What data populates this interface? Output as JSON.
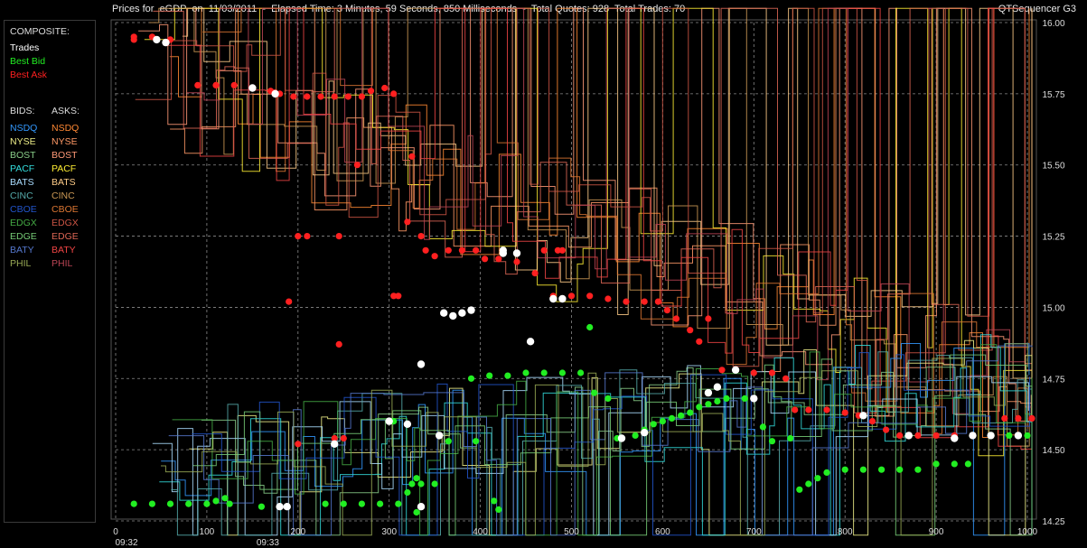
{
  "header": {
    "title": "Prices for  eGDP  on  11/03/2011  -  Elapsed Time: 3 Minutes, 59 Seconds, 850 Milliseconds  -  Total Quotes: 928  Total Trades: 70",
    "app_name": "QTSequencer G3"
  },
  "legend": {
    "composite_header": "COMPOSITE:",
    "composite": [
      {
        "label": "Trades",
        "color": "#ffffff"
      },
      {
        "label": "Best Bid",
        "color": "#22ee22"
      },
      {
        "label": "Best Ask",
        "color": "#ff2020"
      }
    ],
    "bids_header": "BIDS:",
    "asks_header": "ASKS:",
    "exchanges": [
      {
        "bid": "NSDQ",
        "ask": "NSDQ",
        "bid_color": "#3399ff",
        "ask_color": "#ff8833"
      },
      {
        "bid": "NYSE",
        "ask": "NYSE",
        "bid_color": "#eeee88",
        "ask_color": "#ff9966"
      },
      {
        "bid": "BOST",
        "ask": "BOST",
        "bid_color": "#88cc88",
        "ask_color": "#ff9977"
      },
      {
        "bid": "PACF",
        "ask": "PACF",
        "bid_color": "#33dddd",
        "ask_color": "#ffee33"
      },
      {
        "bid": "BATS",
        "ask": "BATS",
        "bid_color": "#aaddff",
        "ask_color": "#ffcc88"
      },
      {
        "bid": "CINC",
        "ask": "CINC",
        "bid_color": "#55aaaa",
        "ask_color": "#cc9955"
      },
      {
        "bid": "CBOE",
        "ask": "CBOE",
        "bid_color": "#2255cc",
        "ask_color": "#dd7733"
      },
      {
        "bid": "EDGX",
        "ask": "EDGX",
        "bid_color": "#44aa44",
        "ask_color": "#cc5544"
      },
      {
        "bid": "EDGE",
        "ask": "EDGE",
        "bid_color": "#77cc77",
        "ask_color": "#dd6655"
      },
      {
        "bid": "BATY",
        "ask": "BATY",
        "bid_color": "#5577cc",
        "ask_color": "#ee4444"
      },
      {
        "bid": "PHIL",
        "ask": "PHIL",
        "bid_color": "#99aa55",
        "ask_color": "#bb4455"
      }
    ]
  },
  "chart_data": {
    "type": "scatter",
    "x_ticks": [
      0,
      100,
      200,
      300,
      400,
      500,
      600,
      700,
      800,
      900,
      1000
    ],
    "time_labels": [
      {
        "x": 0,
        "label": "09:32"
      },
      {
        "x": 155,
        "label": "09:33"
      }
    ],
    "xlim": [
      0,
      1000
    ],
    "y_ticks": [
      "14.25",
      "14.50",
      "14.75",
      "15.00",
      "15.25",
      "15.50",
      "15.75",
      "16.00"
    ],
    "ylim": [
      14.25,
      16.0
    ],
    "grid": true,
    "series": [
      {
        "name": "Best Ask",
        "color": "#ff2020",
        "points": [
          [
            20,
            15.95
          ],
          [
            40,
            15.95
          ],
          [
            60,
            15.94
          ],
          [
            90,
            15.78
          ],
          [
            110,
            15.78
          ],
          [
            130,
            15.78
          ],
          [
            150,
            15.77
          ],
          [
            170,
            15.76
          ],
          [
            180,
            15.75
          ],
          [
            195,
            15.74
          ],
          [
            210,
            15.74
          ],
          [
            225,
            15.74
          ],
          [
            240,
            15.74
          ],
          [
            255,
            15.74
          ],
          [
            270,
            15.74
          ],
          [
            280,
            15.76
          ],
          [
            295,
            15.77
          ],
          [
            305,
            15.75
          ],
          [
            325,
            15.53
          ],
          [
            310,
            15.04
          ],
          [
            305,
            15.04
          ],
          [
            320,
            15.3
          ],
          [
            335,
            15.25
          ],
          [
            340,
            15.2
          ],
          [
            350,
            15.18
          ],
          [
            365,
            15.2
          ],
          [
            380,
            15.2
          ],
          [
            395,
            15.2
          ],
          [
            405,
            15.17
          ],
          [
            420,
            15.17
          ],
          [
            440,
            15.16
          ],
          [
            460,
            15.12
          ],
          [
            470,
            15.2
          ],
          [
            485,
            15.2
          ],
          [
            490,
            15.2
          ],
          [
            480,
            15.04
          ],
          [
            500,
            15.04
          ],
          [
            520,
            15.04
          ],
          [
            540,
            15.03
          ],
          [
            560,
            15.02
          ],
          [
            580,
            15.02
          ],
          [
            595,
            15.02
          ],
          [
            605,
            14.99
          ],
          [
            615,
            14.96
          ],
          [
            630,
            14.92
          ],
          [
            640,
            14.88
          ],
          [
            650,
            14.96
          ],
          [
            665,
            14.78
          ],
          [
            680,
            14.78
          ],
          [
            700,
            14.77
          ],
          [
            720,
            14.77
          ],
          [
            735,
            14.75
          ],
          [
            745,
            14.64
          ],
          [
            760,
            14.64
          ],
          [
            780,
            14.64
          ],
          [
            800,
            14.63
          ],
          [
            815,
            14.62
          ],
          [
            830,
            14.6
          ],
          [
            845,
            14.57
          ],
          [
            860,
            14.55
          ],
          [
            880,
            14.55
          ],
          [
            900,
            14.55
          ],
          [
            920,
            14.55
          ],
          [
            940,
            14.55
          ],
          [
            960,
            14.55
          ],
          [
            975,
            14.61
          ],
          [
            990,
            14.61
          ],
          [
            1005,
            14.61
          ],
          [
            20,
            15.94
          ],
          [
            200,
            15.25
          ],
          [
            210,
            15.25
          ],
          [
            245,
            15.25
          ],
          [
            190,
            15.02
          ],
          [
            200,
            14.52
          ],
          [
            240,
            14.54
          ],
          [
            250,
            14.54
          ],
          [
            265,
            15.5
          ],
          [
            245,
            14.87
          ]
        ]
      },
      {
        "name": "Best Bid",
        "color": "#22ee22",
        "points": [
          [
            20,
            14.31
          ],
          [
            40,
            14.31
          ],
          [
            60,
            14.31
          ],
          [
            80,
            14.31
          ],
          [
            100,
            14.31
          ],
          [
            110,
            14.32
          ],
          [
            120,
            14.33
          ],
          [
            125,
            14.31
          ],
          [
            160,
            14.3
          ],
          [
            180,
            14.3
          ],
          [
            230,
            14.31
          ],
          [
            250,
            14.31
          ],
          [
            270,
            14.31
          ],
          [
            290,
            14.31
          ],
          [
            310,
            14.31
          ],
          [
            320,
            14.35
          ],
          [
            335,
            14.38
          ],
          [
            350,
            14.38
          ],
          [
            305,
            14.6
          ],
          [
            325,
            14.38
          ],
          [
            330,
            14.4
          ],
          [
            390,
            14.75
          ],
          [
            410,
            14.76
          ],
          [
            430,
            14.76
          ],
          [
            450,
            14.77
          ],
          [
            470,
            14.77
          ],
          [
            490,
            14.77
          ],
          [
            510,
            14.77
          ],
          [
            525,
            14.7
          ],
          [
            520,
            14.93
          ],
          [
            540,
            14.68
          ],
          [
            550,
            14.54
          ],
          [
            570,
            14.55
          ],
          [
            580,
            14.57
          ],
          [
            590,
            14.59
          ],
          [
            600,
            14.6
          ],
          [
            610,
            14.61
          ],
          [
            620,
            14.62
          ],
          [
            630,
            14.63
          ],
          [
            640,
            14.65
          ],
          [
            650,
            14.66
          ],
          [
            660,
            14.67
          ],
          [
            670,
            14.68
          ],
          [
            690,
            14.68
          ],
          [
            700,
            14.68
          ],
          [
            710,
            14.58
          ],
          [
            720,
            14.53
          ],
          [
            740,
            14.54
          ],
          [
            750,
            14.36
          ],
          [
            760,
            14.38
          ],
          [
            770,
            14.4
          ],
          [
            780,
            14.42
          ],
          [
            800,
            14.43
          ],
          [
            820,
            14.43
          ],
          [
            840,
            14.43
          ],
          [
            860,
            14.43
          ],
          [
            880,
            14.43
          ],
          [
            900,
            14.45
          ],
          [
            920,
            14.45
          ],
          [
            935,
            14.45
          ],
          [
            960,
            14.55
          ],
          [
            980,
            14.55
          ],
          [
            1000,
            14.55
          ],
          [
            330,
            14.28
          ],
          [
            365,
            14.53
          ],
          [
            395,
            14.53
          ],
          [
            415,
            14.32
          ],
          [
            420,
            14.29
          ]
        ]
      },
      {
        "name": "Trades",
        "color": "#ffffff",
        "points": [
          [
            45,
            15.94
          ],
          [
            55,
            15.93
          ],
          [
            150,
            15.77
          ],
          [
            175,
            15.75
          ],
          [
            180,
            14.3
          ],
          [
            188,
            14.3
          ],
          [
            240,
            14.52
          ],
          [
            300,
            14.6
          ],
          [
            320,
            14.59
          ],
          [
            335,
            14.8
          ],
          [
            360,
            14.98
          ],
          [
            370,
            14.97
          ],
          [
            380,
            14.98
          ],
          [
            390,
            14.99
          ],
          [
            425,
            15.2
          ],
          [
            440,
            15.19
          ],
          [
            455,
            14.88
          ],
          [
            480,
            15.03
          ],
          [
            490,
            15.03
          ],
          [
            555,
            14.54
          ],
          [
            580,
            14.56
          ],
          [
            650,
            14.7
          ],
          [
            660,
            14.72
          ],
          [
            680,
            14.78
          ],
          [
            700,
            14.68
          ],
          [
            820,
            14.62
          ],
          [
            870,
            14.55
          ],
          [
            920,
            14.54
          ],
          [
            940,
            14.55
          ],
          [
            960,
            14.55
          ],
          [
            990,
            14.55
          ],
          [
            335,
            14.3
          ],
          [
            425,
            15.19
          ],
          [
            355,
            14.55
          ]
        ]
      }
    ]
  }
}
